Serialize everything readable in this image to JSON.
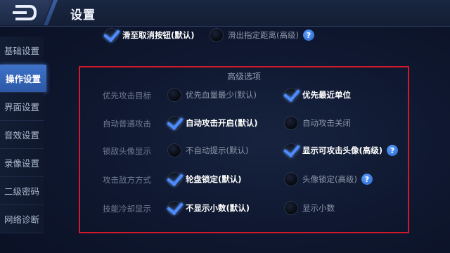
{
  "header": {
    "title": "设置"
  },
  "sidebar": {
    "items": [
      {
        "label": "基础设置",
        "active": false
      },
      {
        "label": "操作设置",
        "active": true
      },
      {
        "label": "界面设置",
        "active": false
      },
      {
        "label": "音效设置",
        "active": false
      },
      {
        "label": "录像设置",
        "active": false
      },
      {
        "label": "二级密码",
        "active": false
      },
      {
        "label": "网络诊断",
        "active": false
      }
    ]
  },
  "top_options": {
    "slide_cancel": {
      "label": "滑至取消按钮(默认)",
      "selected": true
    },
    "slide_distance": {
      "label": "滑出指定距离(高级)",
      "selected": false
    }
  },
  "advanced": {
    "title": "高级选项",
    "rows": [
      {
        "label": "优先攻击目标",
        "left": {
          "label": "优先血量最少(默认)",
          "selected": false
        },
        "right": {
          "label": "优先最近单位",
          "selected": true
        }
      },
      {
        "label": "自动普通攻击",
        "left": {
          "label": "自动攻击开启(默认)",
          "selected": true
        },
        "right": {
          "label": "自动攻击关闭",
          "selected": false
        }
      },
      {
        "label": "锁敌头像显示",
        "left": {
          "label": "不自动提示(默认)",
          "selected": false
        },
        "right": {
          "label": "显示可攻击头像(高级)",
          "selected": true
        }
      },
      {
        "label": "攻击敌方方式",
        "left": {
          "label": "轮盘锁定(默认)",
          "selected": true
        },
        "right": {
          "label": "头像锁定(高级)",
          "selected": false
        }
      },
      {
        "label": "技能冷却显示",
        "left": {
          "label": "不显示小数(默认)",
          "selected": true
        },
        "right": {
          "label": "显示小数",
          "selected": false
        }
      }
    ]
  },
  "colors": {
    "accent": "#4d8bff",
    "highlight_box": "#d0192a",
    "sidebar_active": "#3e73c9"
  },
  "icons": {
    "back": "back-arrow-icon",
    "help": "question-mark-icon"
  }
}
